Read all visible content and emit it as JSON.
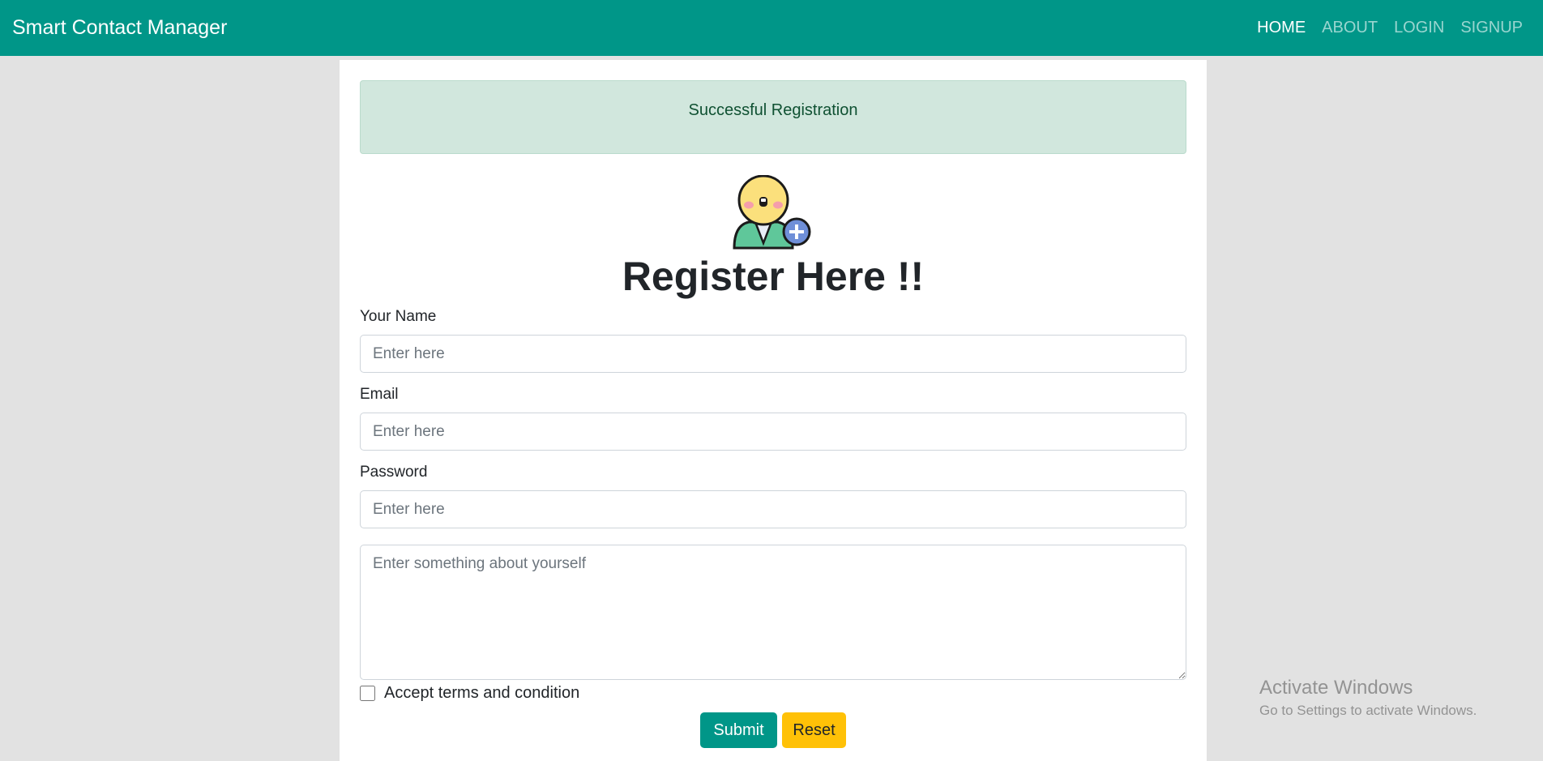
{
  "navbar": {
    "brand": "Smart Contact Manager",
    "links": [
      {
        "label": "HOME",
        "active": true
      },
      {
        "label": "ABOUT",
        "active": false
      },
      {
        "label": "LOGIN",
        "active": false
      },
      {
        "label": "SIGNUP",
        "active": false
      }
    ],
    "color": "#009688"
  },
  "alert": {
    "message": "Successful Registration"
  },
  "form": {
    "logo_icon": "add-user-icon",
    "title": "Register Here !!",
    "name": {
      "label": "Your Name",
      "placeholder": "Enter here",
      "value": ""
    },
    "email": {
      "label": "Email",
      "placeholder": "Enter here",
      "value": ""
    },
    "password": {
      "label": "Password",
      "placeholder": "Enter here",
      "value": ""
    },
    "about": {
      "placeholder": "Enter something about yourself",
      "value": ""
    },
    "terms_label": "Accept terms and condition",
    "terms_checked": false,
    "submit_label": "Submit",
    "reset_label": "Reset"
  },
  "watermark": {
    "title": "Activate Windows",
    "subtitle": "Go to Settings to activate Windows."
  }
}
